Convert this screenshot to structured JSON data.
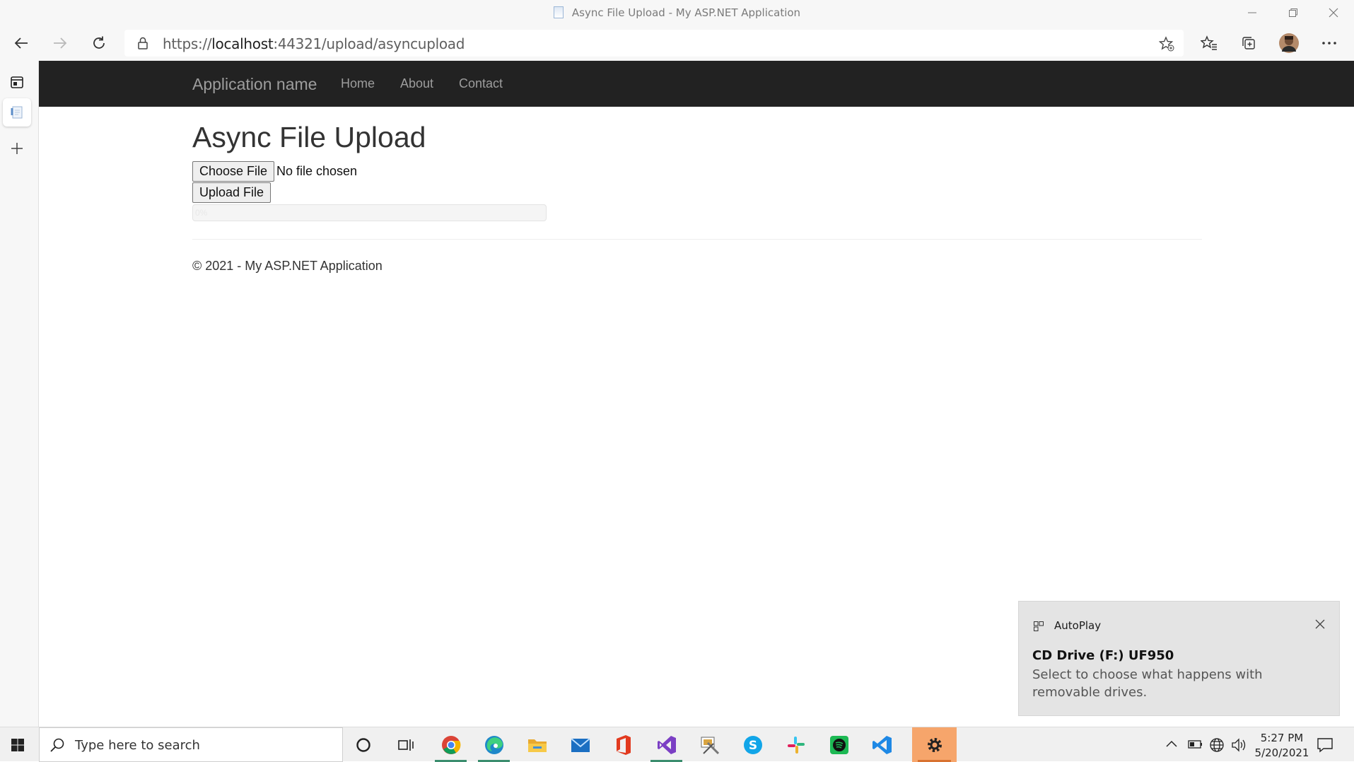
{
  "window": {
    "title": "Async File Upload - My ASP.NET Application"
  },
  "browser": {
    "url_prefix": "https://",
    "url_host": "localhost",
    "url_rest": ":44321/upload/asyncupload"
  },
  "navbar": {
    "brand": "Application name",
    "links": [
      "Home",
      "About",
      "Contact"
    ]
  },
  "main": {
    "heading": "Async File Upload",
    "choose_file_label": "Choose File",
    "no_file_text": "No file chosen",
    "upload_button_label": "Upload File",
    "progress_label": "0%",
    "progress_value": 0
  },
  "footer": {
    "text": "© 2021 - My ASP.NET Application"
  },
  "toast": {
    "app": "AutoPlay",
    "headline": "CD Drive (F:) UF950",
    "body": "Select to choose what happens with removable drives."
  },
  "taskbar": {
    "search_placeholder": "Type here to search",
    "time": "5:27 PM",
    "date": "5/20/2021",
    "apps": [
      "chrome-icon",
      "edge-icon",
      "file-explorer-icon",
      "mail-icon",
      "office-icon",
      "visual-studio-icon",
      "tools-icon",
      "skype-icon",
      "slack-icon",
      "spotify-icon",
      "vscode-icon",
      "settings-icon"
    ]
  },
  "colors": {
    "navbar_bg": "#222222",
    "nav_text": "#9d9d9d",
    "progress_fill": "#337ab7",
    "taskbar_settings_bg": "#f6a56b"
  }
}
